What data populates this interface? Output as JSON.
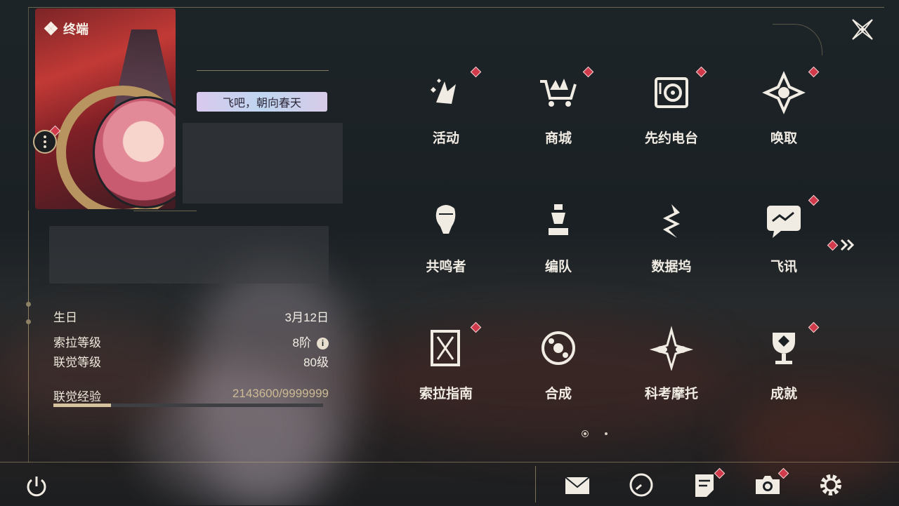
{
  "card": {
    "title": "终端"
  },
  "signature": "飞吧，朝向春天",
  "profile": {
    "birthday_label": "生日",
    "birthday_value": "3月12日",
    "sora_level_label": "索拉等级",
    "sora_level_value": "8阶",
    "union_level_label": "联觉等级",
    "union_level_value": "80级",
    "union_exp_label": "联觉经验",
    "union_exp_value": "2143600/9999999",
    "union_exp_progress": 0.2144
  },
  "menu": [
    {
      "label": "活动",
      "icon": "activity-icon",
      "badge": true
    },
    {
      "label": "商城",
      "icon": "shop-cart-icon",
      "badge": true
    },
    {
      "label": "先约电台",
      "icon": "radio-icon",
      "badge": true
    },
    {
      "label": "唤取",
      "icon": "gacha-star-icon",
      "badge": true
    },
    {
      "label": "共鸣者",
      "icon": "resonator-icon",
      "badge": false
    },
    {
      "label": "编队",
      "icon": "team-chess-icon",
      "badge": false
    },
    {
      "label": "数据坞",
      "icon": "databank-icon",
      "badge": false
    },
    {
      "label": "飞讯",
      "icon": "message-icon",
      "badge": true
    },
    {
      "label": "索拉指南",
      "icon": "guidebook-icon",
      "badge": true
    },
    {
      "label": "合成",
      "icon": "synthesis-icon",
      "badge": false
    },
    {
      "label": "科考摩托",
      "icon": "motorbike-icon",
      "badge": false
    },
    {
      "label": "成就",
      "icon": "trophy-icon",
      "badge": true
    }
  ],
  "pager": {
    "current": 1,
    "total": 2
  },
  "bottom": [
    "power-icon",
    "mail-icon",
    "clock-icon",
    "notes-icon",
    "camera-icon",
    "settings-gear-icon"
  ],
  "colors": {
    "accent": "#d6c29c",
    "badge": "#d13a4b",
    "text": "#f1ece3"
  }
}
